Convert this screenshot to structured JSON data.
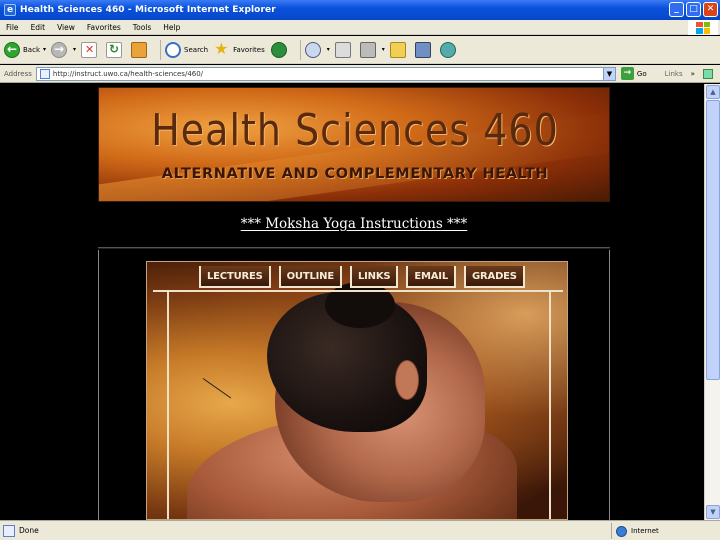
{
  "window": {
    "title": "Health Sciences 460 - Microsoft Internet Explorer",
    "controls": {
      "minimize": "_",
      "maximize": "□",
      "close": "✕"
    }
  },
  "menu": [
    "File",
    "Edit",
    "View",
    "Favorites",
    "Tools",
    "Help"
  ],
  "toolbar": {
    "back_label": "Back",
    "search_label": "Search",
    "favorites_label": "Favorites"
  },
  "address": {
    "label": "Address",
    "url": "http://instruct.uwo.ca/health-sciences/460/",
    "go_label": "Go",
    "links_label": "Links",
    "more": "»"
  },
  "page": {
    "banner_title": "Health Sciences 460",
    "banner_subtitle": "ALTERNATIVE AND COMPLEMENTARY HEALTH",
    "heading": "*** Moksha Yoga Instructions ***",
    "nav": [
      "LECTURES",
      "OUTLINE",
      "LINKS",
      "EMAIL",
      "GRADES"
    ]
  },
  "status": {
    "text": "Done",
    "zone": "Internet"
  },
  "colors": {
    "titlebar": "#0a53dc",
    "chrome": "#ece9d8",
    "page_bg": "#000000",
    "banner_orange": "#d06a18"
  }
}
